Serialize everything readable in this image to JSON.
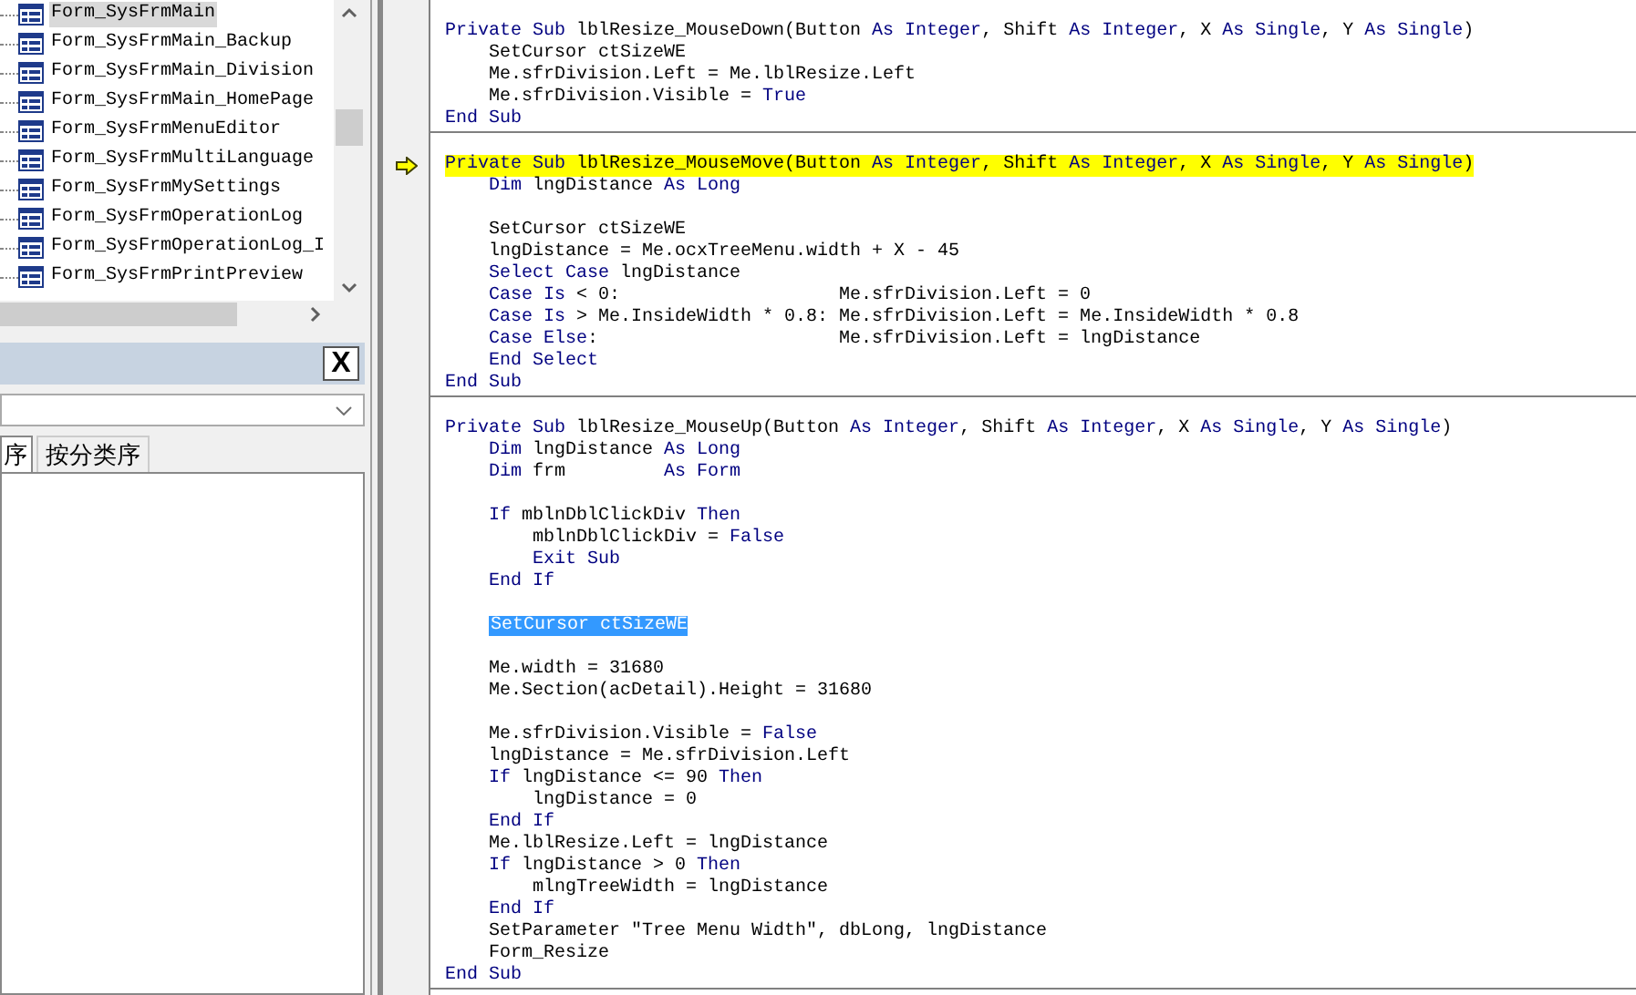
{
  "tree": {
    "items": [
      {
        "label": "Form_SysFrmMain",
        "selected": true
      },
      {
        "label": "Form_SysFrmMain_Backup",
        "selected": false
      },
      {
        "label": "Form_SysFrmMain_Division",
        "selected": false
      },
      {
        "label": "Form_SysFrmMain_HomePage",
        "selected": false
      },
      {
        "label": "Form_SysFrmMenuEditor",
        "selected": false
      },
      {
        "label": "Form_SysFrmMultiLanguage",
        "selected": false
      },
      {
        "label": "Form_SysFrmMySettings",
        "selected": false
      },
      {
        "label": "Form_SysFrmOperationLog",
        "selected": false
      },
      {
        "label": "Form_SysFrmOperationLog_I",
        "selected": false
      },
      {
        "label": "Form_SysFrmPrintPreview",
        "selected": false
      }
    ]
  },
  "properties": {
    "close_button": "X",
    "tabs": [
      {
        "label": "序",
        "selected": true
      },
      {
        "label": "按分类序",
        "selected": false
      }
    ]
  },
  "code": {
    "procedures": [
      {
        "lines": [
          {
            "kind": "blank"
          },
          {
            "kind": "code",
            "current": false,
            "segments": [
              {
                "text": "Private Sub",
                "kind": "keyword"
              },
              {
                "text": " lblResize_MouseDown(Button ",
                "kind": "plain"
              },
              {
                "text": "As Integer",
                "kind": "keyword"
              },
              {
                "text": ", Shift ",
                "kind": "plain"
              },
              {
                "text": "As Integer",
                "kind": "keyword"
              },
              {
                "text": ", X ",
                "kind": "plain"
              },
              {
                "text": "As Single",
                "kind": "keyword"
              },
              {
                "text": ", Y ",
                "kind": "plain"
              },
              {
                "text": "As Single",
                "kind": "keyword"
              },
              {
                "text": ")",
                "kind": "plain"
              }
            ]
          },
          {
            "kind": "code",
            "current": false,
            "segments": [
              {
                "text": "    SetCursor ctSizeWE",
                "kind": "plain"
              }
            ]
          },
          {
            "kind": "code",
            "current": false,
            "segments": [
              {
                "text": "    Me.sfrDivision.Left = Me.lblResize.Left",
                "kind": "plain"
              }
            ]
          },
          {
            "kind": "code",
            "current": false,
            "segments": [
              {
                "text": "    Me.sfrDivision.Visible = ",
                "kind": "plain"
              },
              {
                "text": "True",
                "kind": "keyword"
              }
            ]
          },
          {
            "kind": "code",
            "current": false,
            "segments": [
              {
                "text": "End Sub",
                "kind": "keyword"
              }
            ]
          }
        ]
      },
      {
        "lines": [
          {
            "kind": "blank"
          },
          {
            "kind": "code",
            "current": true,
            "segments": [
              {
                "text": "Private Sub",
                "kind": "keyword"
              },
              {
                "text": " lblResize_MouseMove(Button ",
                "kind": "plain"
              },
              {
                "text": "As Integer",
                "kind": "keyword"
              },
              {
                "text": ", Shift ",
                "kind": "plain"
              },
              {
                "text": "As Integer",
                "kind": "keyword"
              },
              {
                "text": ", X ",
                "kind": "plain"
              },
              {
                "text": "As Single",
                "kind": "keyword"
              },
              {
                "text": ", Y ",
                "kind": "plain"
              },
              {
                "text": "As Single",
                "kind": "keyword"
              },
              {
                "text": ")",
                "kind": "plain"
              }
            ]
          },
          {
            "kind": "code",
            "current": false,
            "segments": [
              {
                "text": "    Dim",
                "kind": "keyword"
              },
              {
                "text": " lngDistance ",
                "kind": "plain"
              },
              {
                "text": "As Long",
                "kind": "keyword"
              }
            ]
          },
          {
            "kind": "blank"
          },
          {
            "kind": "code",
            "current": false,
            "segments": [
              {
                "text": "    SetCursor ctSizeWE",
                "kind": "plain"
              }
            ]
          },
          {
            "kind": "code",
            "current": false,
            "segments": [
              {
                "text": "    lngDistance = Me.ocxTreeMenu.width + X - 45",
                "kind": "plain"
              }
            ]
          },
          {
            "kind": "code",
            "current": false,
            "segments": [
              {
                "text": "    Select Case",
                "kind": "keyword"
              },
              {
                "text": " lngDistance",
                "kind": "plain"
              }
            ]
          },
          {
            "kind": "code",
            "current": false,
            "segments": [
              {
                "text": "    Case Is",
                "kind": "keyword"
              },
              {
                "text": " < 0:                    Me.sfrDivision.Left = 0",
                "kind": "plain"
              }
            ]
          },
          {
            "kind": "code",
            "current": false,
            "segments": [
              {
                "text": "    Case Is",
                "kind": "keyword"
              },
              {
                "text": " > Me.InsideWidth * 0.8: Me.sfrDivision.Left = Me.InsideWidth * 0.8",
                "kind": "plain"
              }
            ]
          },
          {
            "kind": "code",
            "current": false,
            "segments": [
              {
                "text": "    Case Else",
                "kind": "keyword"
              },
              {
                "text": ":                      Me.sfrDivision.Left = lngDistance",
                "kind": "plain"
              }
            ]
          },
          {
            "kind": "code",
            "current": false,
            "segments": [
              {
                "text": "    End Select",
                "kind": "keyword"
              }
            ]
          },
          {
            "kind": "code",
            "current": false,
            "segments": [
              {
                "text": "End Sub",
                "kind": "keyword"
              }
            ]
          }
        ]
      },
      {
        "lines": [
          {
            "kind": "blank"
          },
          {
            "kind": "code",
            "current": false,
            "segments": [
              {
                "text": "Private Sub",
                "kind": "keyword"
              },
              {
                "text": " lblResize_MouseUp(Button ",
                "kind": "plain"
              },
              {
                "text": "As Integer",
                "kind": "keyword"
              },
              {
                "text": ", Shift ",
                "kind": "plain"
              },
              {
                "text": "As Integer",
                "kind": "keyword"
              },
              {
                "text": ", X ",
                "kind": "plain"
              },
              {
                "text": "As Single",
                "kind": "keyword"
              },
              {
                "text": ", Y ",
                "kind": "plain"
              },
              {
                "text": "As Single",
                "kind": "keyword"
              },
              {
                "text": ")",
                "kind": "plain"
              }
            ]
          },
          {
            "kind": "code",
            "current": false,
            "segments": [
              {
                "text": "    Dim",
                "kind": "keyword"
              },
              {
                "text": " lngDistance ",
                "kind": "plain"
              },
              {
                "text": "As Long",
                "kind": "keyword"
              }
            ]
          },
          {
            "kind": "code",
            "current": false,
            "segments": [
              {
                "text": "    Dim",
                "kind": "keyword"
              },
              {
                "text": " frm         ",
                "kind": "plain"
              },
              {
                "text": "As Form",
                "kind": "keyword"
              }
            ]
          },
          {
            "kind": "blank"
          },
          {
            "kind": "code",
            "current": false,
            "segments": [
              {
                "text": "    If",
                "kind": "keyword"
              },
              {
                "text": " mblnDblClickDiv ",
                "kind": "plain"
              },
              {
                "text": "Then",
                "kind": "keyword"
              }
            ]
          },
          {
            "kind": "code",
            "current": false,
            "segments": [
              {
                "text": "        mblnDblClickDiv = ",
                "kind": "plain"
              },
              {
                "text": "False",
                "kind": "keyword"
              }
            ]
          },
          {
            "kind": "code",
            "current": false,
            "segments": [
              {
                "text": "        Exit Sub",
                "kind": "keyword"
              }
            ]
          },
          {
            "kind": "code",
            "current": false,
            "segments": [
              {
                "text": "    End If",
                "kind": "keyword"
              }
            ]
          },
          {
            "kind": "blank"
          },
          {
            "kind": "code",
            "current": false,
            "segments": [
              {
                "text": "    SetCursor ctSizeWE",
                "kind": "selection"
              }
            ]
          },
          {
            "kind": "blank"
          },
          {
            "kind": "code",
            "current": false,
            "segments": [
              {
                "text": "    Me.width = 31680",
                "kind": "plain"
              }
            ]
          },
          {
            "kind": "code",
            "current": false,
            "segments": [
              {
                "text": "    Me.Section(acDetail).Height = 31680",
                "kind": "plain"
              }
            ]
          },
          {
            "kind": "blank"
          },
          {
            "kind": "code",
            "current": false,
            "segments": [
              {
                "text": "    Me.sfrDivision.Visible = ",
                "kind": "plain"
              },
              {
                "text": "False",
                "kind": "keyword"
              }
            ]
          },
          {
            "kind": "code",
            "current": false,
            "segments": [
              {
                "text": "    lngDistance = Me.sfrDivision.Left",
                "kind": "plain"
              }
            ]
          },
          {
            "kind": "code",
            "current": false,
            "segments": [
              {
                "text": "    If",
                "kind": "keyword"
              },
              {
                "text": " lngDistance <= 90 ",
                "kind": "plain"
              },
              {
                "text": "Then",
                "kind": "keyword"
              }
            ]
          },
          {
            "kind": "code",
            "current": false,
            "segments": [
              {
                "text": "        lngDistance = 0",
                "kind": "plain"
              }
            ]
          },
          {
            "kind": "code",
            "current": false,
            "segments": [
              {
                "text": "    End If",
                "kind": "keyword"
              }
            ]
          },
          {
            "kind": "code",
            "current": false,
            "segments": [
              {
                "text": "    Me.lblResize.Left = lngDistance",
                "kind": "plain"
              }
            ]
          },
          {
            "kind": "code",
            "current": false,
            "segments": [
              {
                "text": "    If",
                "kind": "keyword"
              },
              {
                "text": " lngDistance > 0 ",
                "kind": "plain"
              },
              {
                "text": "Then",
                "kind": "keyword"
              }
            ]
          },
          {
            "kind": "code",
            "current": false,
            "segments": [
              {
                "text": "        mlngTreeWidth = lngDistance",
                "kind": "plain"
              }
            ]
          },
          {
            "kind": "code",
            "current": false,
            "segments": [
              {
                "text": "    End If",
                "kind": "keyword"
              }
            ]
          },
          {
            "kind": "code",
            "current": false,
            "segments": [
              {
                "text": "    SetParameter \"Tree Menu Width\", dbLong, lngDistance",
                "kind": "plain"
              }
            ]
          },
          {
            "kind": "code",
            "current": false,
            "segments": [
              {
                "text": "    Form_Resize",
                "kind": "plain"
              }
            ]
          },
          {
            "kind": "code",
            "current": false,
            "segments": [
              {
                "text": "End Sub",
                "kind": "keyword"
              }
            ]
          }
        ]
      }
    ]
  }
}
